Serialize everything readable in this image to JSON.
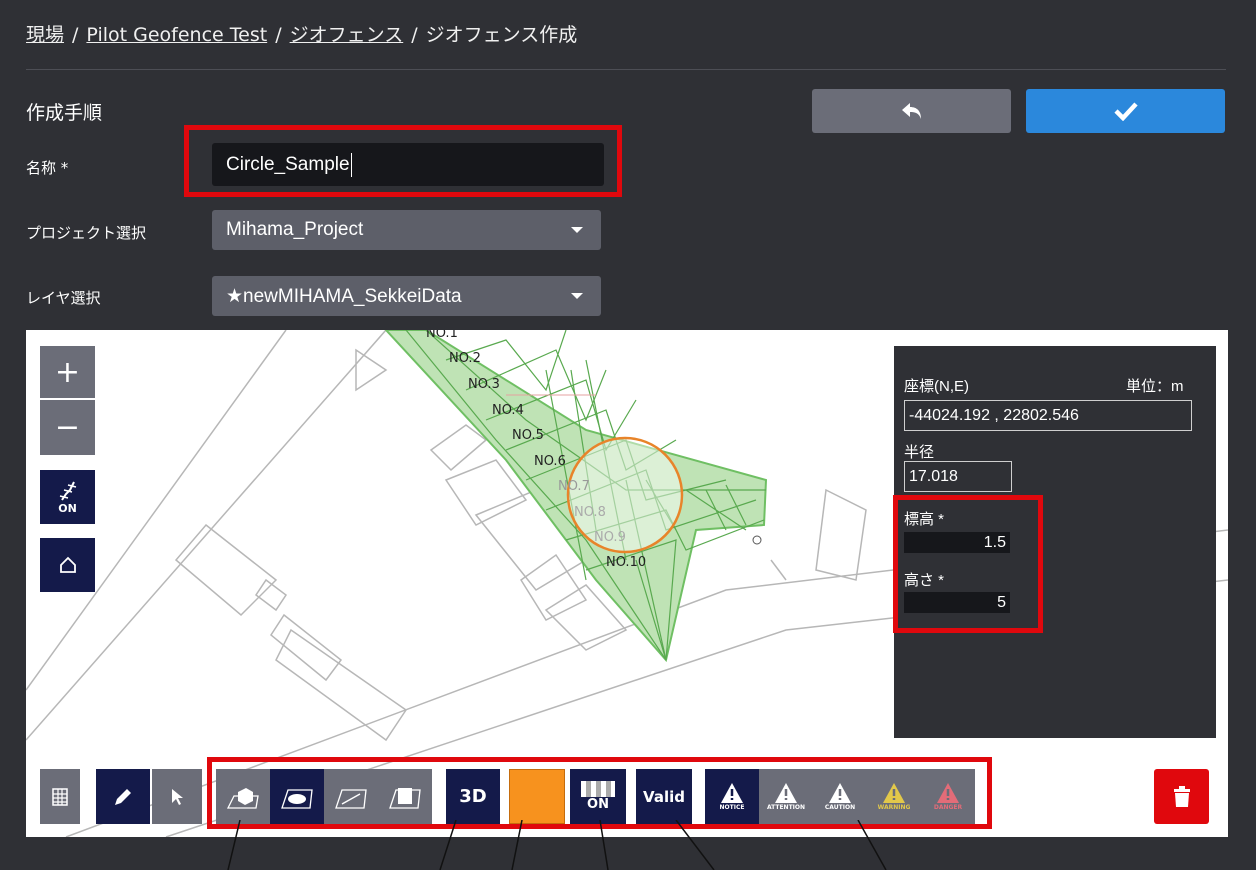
{
  "breadcrumb": {
    "home": "現場",
    "site": "Pilot Geofence Test",
    "geofence": "ジオフェンス",
    "current": "ジオフェンス作成",
    "separator": "/"
  },
  "form": {
    "section_title": "作成手順",
    "name_label": "名称 *",
    "name_value": "Circle_Sample",
    "project_label": "プロジェクト選択",
    "project_value": "Mihama_Project",
    "layer_label": "レイヤ選択",
    "layer_value": "★newMIHAMA_SekkeiData"
  },
  "actions": {
    "back_icon": "undo-arrow-icon",
    "confirm_icon": "checkmark-icon",
    "back_color": "#6b6d78",
    "confirm_color": "#2b88dc"
  },
  "map": {
    "zoom_in": "+",
    "zoom_out": "−",
    "layer_toggle": "ON",
    "stations": [
      "NO.1",
      "NO.2",
      "NO.3",
      "NO.4",
      "NO.5",
      "NO.6",
      "NO.7",
      "NO.8",
      "NO.9",
      "NO.10"
    ],
    "geofence_color": "#e8842a",
    "design_color": "#5fb95a"
  },
  "panel": {
    "coord_label": "座標(N,E)",
    "unit_label": "単位：m",
    "coord_value": "-44024.192 , 22802.546",
    "radius_label": "半径",
    "radius_value": "17.018",
    "elevation_label": "標高 *",
    "elevation_value": "1.5",
    "height_label": "高さ *",
    "height_value": "5"
  },
  "toolbar": {
    "view3d": "3D",
    "transparency": "ON",
    "valid": "Valid",
    "fill_color": "#f7921e",
    "levels": [
      "NOTICE",
      "ATTENTION",
      "CAUTION",
      "WARNING",
      "DANGER"
    ],
    "delete_color": "#e0080d"
  },
  "highlight_color": "#e0080d"
}
